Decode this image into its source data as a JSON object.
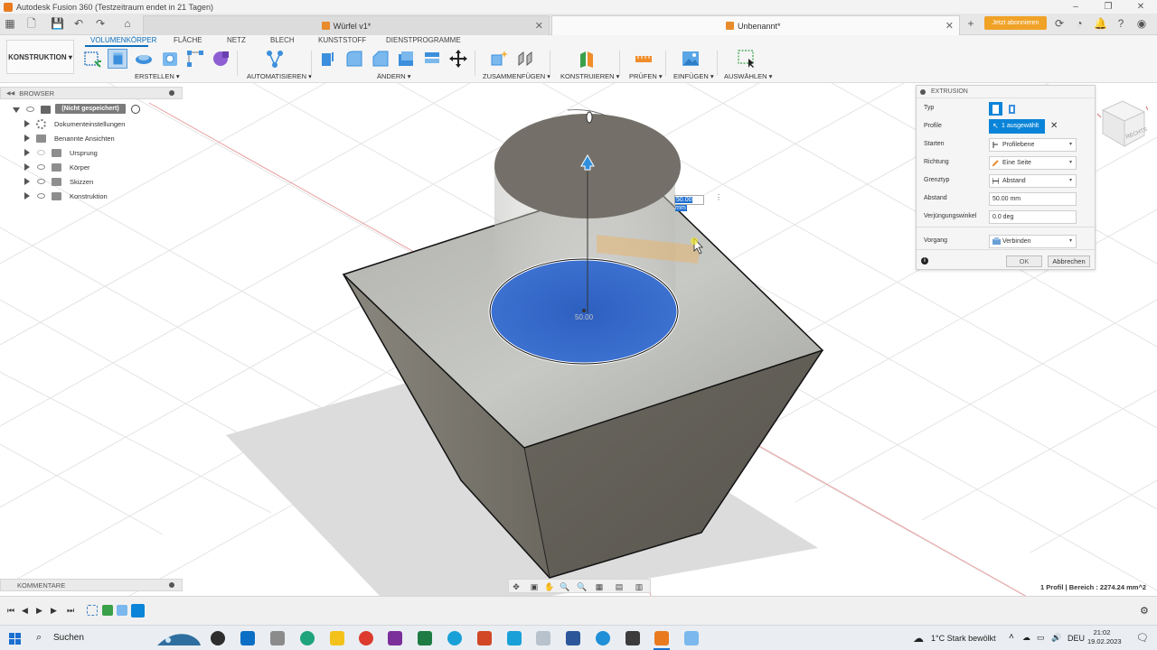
{
  "window": {
    "title": "Autodesk Fusion 360 (Testzeitraum endet in 21 Tagen)",
    "controls": [
      "–",
      "❐",
      "✕"
    ]
  },
  "tabs": [
    {
      "label": "Würfel v1*",
      "active": false
    },
    {
      "label": "Unbenannt*",
      "active": true
    }
  ],
  "subscribe_label": "Jetzt abonnieren",
  "toolbar": {
    "workspace": "KONSTRUKTION ▾",
    "tabs": [
      "VOLUMENKÖRPER",
      "FLÄCHE",
      "NETZ",
      "BLECH",
      "KUNSTSTOFF",
      "DIENSTPROGRAMME"
    ],
    "active_tab": "VOLUMENKÖRPER",
    "groups": [
      "ERSTELLEN ▾",
      "AUTOMATISIEREN ▾",
      "ÄNDERN ▾",
      "ZUSAMMENFÜGEN ▾",
      "KONSTRUIEREN ▾",
      "PRÜFEN ▾",
      "EINFÜGEN ▾",
      "AUSWÄHLEN ▾"
    ]
  },
  "browser": {
    "header": "BROWSER",
    "root_label": "(Nicht gespeichert)",
    "items": [
      {
        "label": "Dokumenteinstellungen",
        "icon": "gear-icon"
      },
      {
        "label": "Benannte Ansichten",
        "icon": "folder-icon"
      },
      {
        "label": "Ursprung",
        "icon": "folder-icon"
      },
      {
        "label": "Körper",
        "icon": "folder-icon"
      },
      {
        "label": "Skizzen",
        "icon": "folder-icon"
      },
      {
        "label": "Konstruktion",
        "icon": "folder-icon"
      }
    ]
  },
  "comments_label": "KOMMENTARE",
  "extrusion": {
    "title": "EXTRUSION",
    "rows": {
      "typ": {
        "label": "Typ"
      },
      "profile": {
        "label": "Profile",
        "value": "1 ausgewählt"
      },
      "starten": {
        "label": "Starten",
        "value": "Profilebene"
      },
      "richtung": {
        "label": "Richtung",
        "value": "Eine Seite"
      },
      "grenztyp": {
        "label": "Grenztyp",
        "value": "Abstand"
      },
      "abstand": {
        "label": "Abstand",
        "value": "50.00 mm"
      },
      "winkel": {
        "label": "Verjüngungswinkel",
        "value": "0.0 deg"
      },
      "vorgang": {
        "label": "Vorgang",
        "value": "Verbinden"
      }
    },
    "ok_label": "OK",
    "cancel_label": "Abbrechen"
  },
  "viewport": {
    "measure_value": "50.00 mm",
    "ghost_dim": "50.00",
    "viewcube_label": "RECHTS",
    "status": "1 Profil | Bereich : 2274.24 mm^2"
  },
  "taskbar": {
    "search_label": "Suchen",
    "weather": "1°C  Stark bewölkt",
    "lang": "DEU",
    "time": "21:02",
    "date": "19.02.2023"
  },
  "colors": {
    "accent": "#0a84d8",
    "subscribe": "#f0a227",
    "profile_face": "#2c5fc2",
    "body": "#6e6b63"
  }
}
